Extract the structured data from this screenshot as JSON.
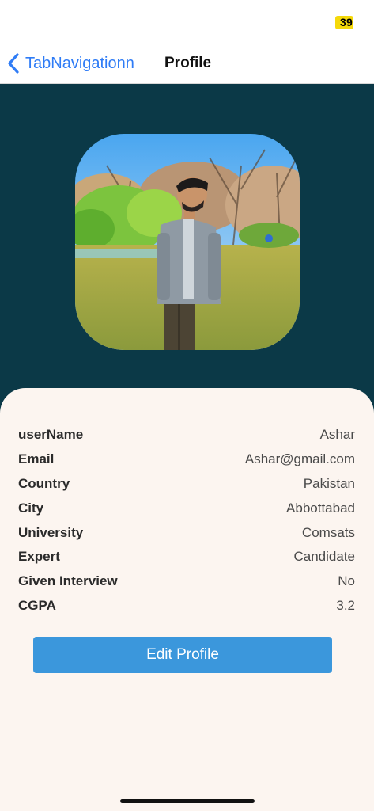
{
  "status_bar": {
    "battery_level": "39",
    "battery_color": "#f5d90a"
  },
  "nav": {
    "back_label": "TabNavigationn",
    "title": "Profile",
    "back_icon": "chevron-left-icon",
    "accent": "#2f7cf6"
  },
  "hero": {
    "background": "#0b3947",
    "avatar": "profile-photo"
  },
  "profile": {
    "rows": [
      {
        "label": "userName",
        "value": "Ashar"
      },
      {
        "label": "Email",
        "value": "Ashar@gmail.com"
      },
      {
        "label": "Country",
        "value": "Pakistan"
      },
      {
        "label": "City",
        "value": "Abbottabad"
      },
      {
        "label": "University",
        "value": "Comsats"
      },
      {
        "label": "Expert",
        "value": "Candidate"
      },
      {
        "label": "Given Interview",
        "value": "No"
      },
      {
        "label": "CGPA",
        "value": "3.2"
      }
    ],
    "card_background": "#fcf5f0"
  },
  "actions": {
    "edit_label": "Edit Profile",
    "edit_color": "#3b97dc"
  }
}
